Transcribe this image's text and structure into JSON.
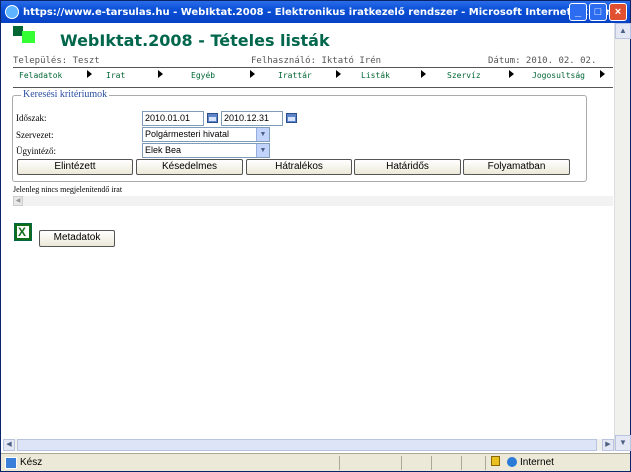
{
  "window": {
    "title": "https://www.e-tarsulas.hu - WebIktat.2008 - Elektronikus iratkezelő rendszer - Microsoft Internet Explorer",
    "minimize": "_",
    "maximize": "□",
    "close": "×"
  },
  "header": {
    "app_title": "WebIktat.2008 - Tételes listák",
    "telepules_label": "Település: Teszt",
    "felhasznalo_label": "Felhasználó: Iktató Irén",
    "datum_label": "Dátum: 2010. 02. 02."
  },
  "menu": {
    "items": [
      {
        "label": "Feladatok"
      },
      {
        "label": "Irat"
      },
      {
        "label": "Egyéb"
      },
      {
        "label": "Irattár"
      },
      {
        "label": "Listák"
      },
      {
        "label": "Szervíz"
      },
      {
        "label": "Jogosultság"
      }
    ]
  },
  "search": {
    "legend": "Keresési kritériumok",
    "idoszak_label": "Időszak:",
    "date_from": "2010.01.01",
    "date_to": "2010.12.31",
    "szervezet_label": "Szervezet:",
    "szervezet_value": "Polgármesteri hivatal",
    "ugyintezo_label": "Ügyintéző:",
    "ugyintezo_value": "Elek Bea",
    "buttons": {
      "elintezett": "Elintézett",
      "keselmes": "Késedelmes",
      "hatralekos": "Hátralékos",
      "hatarido": "Határidős",
      "folyamatban": "Folyamatban"
    }
  },
  "results": {
    "empty_message": "Jelenleg nincs megjelenítendő irat",
    "export_button": "Metadatok"
  },
  "status": {
    "left_text": "Kész",
    "zone_text": "Internet"
  },
  "icons": {
    "excel": "X"
  }
}
